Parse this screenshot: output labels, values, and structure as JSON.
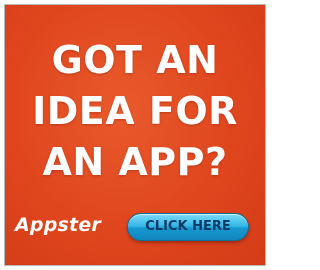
{
  "ad": {
    "headline_lines": [
      "GOT AN",
      "IDEA FOR",
      "AN APP?"
    ],
    "brand": "Appster",
    "cta_label": "CLICK HERE",
    "colors": {
      "background": "#e0461e",
      "text": "#ffffff",
      "button": "#36b8e8",
      "button_text": "#0b3a66"
    }
  }
}
